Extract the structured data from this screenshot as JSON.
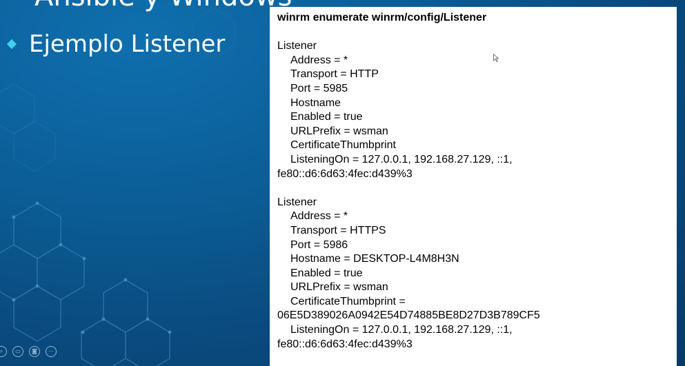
{
  "slide": {
    "title": "Ansible y Windows",
    "bullet": "Ejemplo Listener"
  },
  "code": {
    "command": "winrm enumerate winrm/config/Listener",
    "lines": [
      {
        "text": "",
        "indent": false
      },
      {
        "text": "Listener",
        "indent": false
      },
      {
        "text": "Address = *",
        "indent": true
      },
      {
        "text": "Transport = HTTP",
        "indent": true
      },
      {
        "text": "Port = 5985",
        "indent": true
      },
      {
        "text": "Hostname",
        "indent": true
      },
      {
        "text": "Enabled = true",
        "indent": true
      },
      {
        "text": "URLPrefix = wsman",
        "indent": true
      },
      {
        "text": "CertificateThumbprint",
        "indent": true
      },
      {
        "text": "ListeningOn = 127.0.0.1, 192.168.27.129, ::1,",
        "indent": true
      },
      {
        "text": "fe80::d6:6d63:4fec:d439%3",
        "indent": false
      },
      {
        "text": "",
        "indent": false
      },
      {
        "text": "Listener",
        "indent": false
      },
      {
        "text": "Address = *",
        "indent": true
      },
      {
        "text": "Transport = HTTPS",
        "indent": true
      },
      {
        "text": "Port = 5986",
        "indent": true
      },
      {
        "text": "Hostname = DESKTOP-L4M8H3N",
        "indent": true
      },
      {
        "text": "Enabled = true",
        "indent": true
      },
      {
        "text": "URLPrefix = wsman",
        "indent": true
      },
      {
        "text": "CertificateThumbprint =",
        "indent": true
      },
      {
        "text": "06E5D389026A0942E54D74885BE8D27D3B789CF5",
        "indent": false
      },
      {
        "text": "ListeningOn = 127.0.0.1, 192.168.27.129, ::1,",
        "indent": true
      },
      {
        "text": "fe80::d6:6d63:4fec:d439%3",
        "indent": false
      }
    ]
  },
  "controls": [
    {
      "name": "zoom-control",
      "icon": "magnifier-icon",
      "glyph": "⌕"
    },
    {
      "name": "subtitle-control",
      "icon": "subtitles-icon",
      "glyph": "▭"
    },
    {
      "name": "camera-control",
      "icon": "camera-icon",
      "glyph": "◙"
    },
    {
      "name": "more-options-control",
      "icon": "more-icon",
      "glyph": "⋯"
    }
  ],
  "colors": {
    "accent": "#3fd0f0",
    "background": "#0b5e97"
  }
}
